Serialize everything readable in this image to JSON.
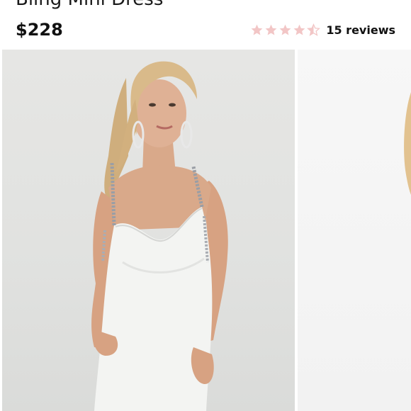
{
  "product": {
    "title": "Bling Mini Dress",
    "price": "$228"
  },
  "rating": {
    "stars": 4.5,
    "reviews_label": "15 reviews",
    "star_color": "#f2c6c6"
  },
  "gallery": {
    "images": [
      {
        "name": "model-front-photo"
      },
      {
        "name": "model-side-photo"
      }
    ]
  }
}
